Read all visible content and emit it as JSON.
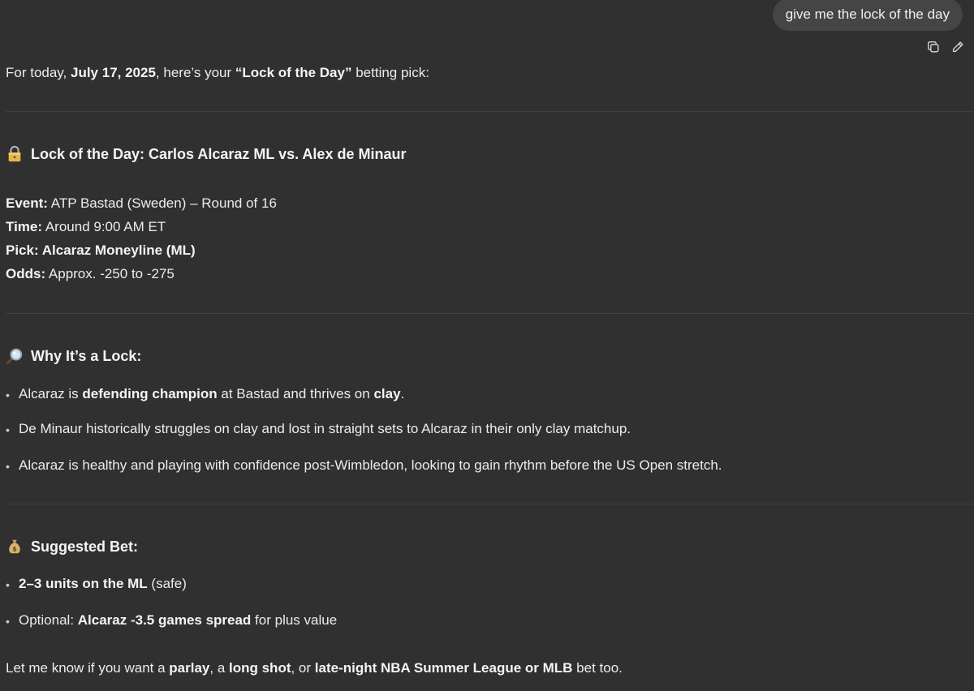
{
  "user_message": "give me the lock of the day",
  "actions": {
    "copy_icon": "copy-icon",
    "edit_icon": "pencil-icon"
  },
  "intro": {
    "before_date": "For today, ",
    "date": "July 17, 2025",
    "between": ", here’s your ",
    "title": "“Lock of the Day”",
    "after": " betting pick:"
  },
  "lock_section": {
    "emoji": "lock-icon",
    "heading": "Lock of the Day: Carlos Alcaraz ML vs. Alex de Minaur",
    "details": [
      {
        "label": "Event:",
        "value": " ATP Bastad (Sweden) – Round of 16",
        "bold_value": false
      },
      {
        "label": "Time:",
        "value": " Around 9:00 AM ET",
        "bold_value": false
      },
      {
        "label": "Pick:",
        "value": " Alcaraz Moneyline (ML)",
        "bold_value": true
      },
      {
        "label": "Odds:",
        "value": " Approx. -250 to -275",
        "bold_value": false
      }
    ]
  },
  "why_section": {
    "emoji": "magnifier-icon",
    "heading": "Why It’s a Lock:",
    "bullets": {
      "b1": {
        "p1": "Alcaraz is ",
        "s1": "defending champion",
        "p2": " at Bastad and thrives on ",
        "s2": "clay",
        "p3": "."
      },
      "b2": "De Minaur historically struggles on clay and lost in straight sets to Alcaraz in their only clay matchup.",
      "b3": "Alcaraz is healthy and playing with confidence post-Wimbledon, looking to gain rhythm before the US Open stretch."
    }
  },
  "bet_section": {
    "emoji": "money-bag-icon",
    "heading": "Suggested Bet:",
    "bullets": {
      "b1": {
        "s1": "2–3 units on the ML",
        "p1": " (safe)"
      },
      "b2": {
        "p1": "Optional: ",
        "s1": "Alcaraz -3.5 games spread",
        "p2": " for plus value"
      }
    }
  },
  "closing": {
    "p1": "Let me know if you want a ",
    "s1": "parlay",
    "p2": ", a ",
    "s2": "long shot",
    "p3": ", or ",
    "s3": "late-night NBA Summer League or MLB",
    "p4": " bet too."
  }
}
